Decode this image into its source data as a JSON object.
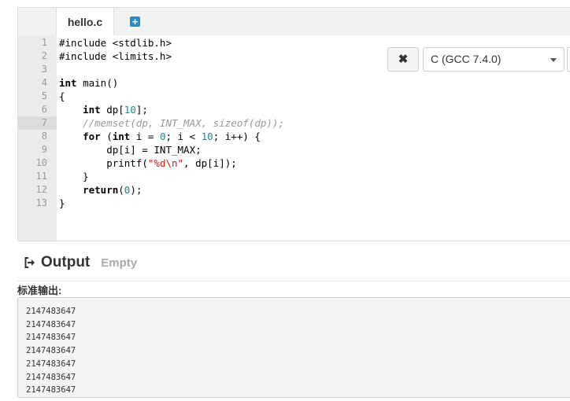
{
  "tabs": {
    "active": "hello.c",
    "add_icon": "plus-square-icon"
  },
  "toolbar": {
    "clear_icon": "✖",
    "language": "C (GCC 7.4.0)"
  },
  "editor": {
    "active_line": 7,
    "lines": [
      {
        "n": "1"
      },
      {
        "n": "2"
      },
      {
        "n": "3"
      },
      {
        "n": "4"
      },
      {
        "n": "5"
      },
      {
        "n": "6"
      },
      {
        "n": "7"
      },
      {
        "n": "8"
      },
      {
        "n": "9"
      },
      {
        "n": "10"
      },
      {
        "n": "11"
      },
      {
        "n": "12"
      },
      {
        "n": "13"
      }
    ],
    "code": [
      [
        {
          "t": "#include <stdlib.h>",
          "c": ""
        }
      ],
      [
        {
          "t": "#include <limits.h>",
          "c": ""
        }
      ],
      [],
      [
        {
          "t": "int",
          "c": "kw"
        },
        {
          "t": " main()",
          "c": ""
        }
      ],
      [
        {
          "t": "{",
          "c": ""
        }
      ],
      [
        {
          "t": "    ",
          "c": ""
        },
        {
          "t": "int",
          "c": "kw"
        },
        {
          "t": " dp[",
          "c": ""
        },
        {
          "t": "10",
          "c": "num"
        },
        {
          "t": "];",
          "c": ""
        }
      ],
      [
        {
          "t": "    ",
          "c": ""
        },
        {
          "t": "//memset(dp, INT_MAX, sizeof(dp));",
          "c": "cmt"
        }
      ],
      [
        {
          "t": "    ",
          "c": ""
        },
        {
          "t": "for",
          "c": "kw"
        },
        {
          "t": " (",
          "c": ""
        },
        {
          "t": "int",
          "c": "kw"
        },
        {
          "t": " i = ",
          "c": ""
        },
        {
          "t": "0",
          "c": "num"
        },
        {
          "t": "; i < ",
          "c": ""
        },
        {
          "t": "10",
          "c": "num"
        },
        {
          "t": "; i++) {",
          "c": ""
        }
      ],
      [
        {
          "t": "        dp[i] = INT_MAX;",
          "c": ""
        }
      ],
      [
        {
          "t": "        printf(",
          "c": ""
        },
        {
          "t": "\"%d\\n\"",
          "c": "str"
        },
        {
          "t": ", dp[i]);",
          "c": ""
        }
      ],
      [
        {
          "t": "    }",
          "c": ""
        }
      ],
      [
        {
          "t": "    ",
          "c": ""
        },
        {
          "t": "return",
          "c": "kw"
        },
        {
          "t": "(",
          "c": ""
        },
        {
          "t": "0",
          "c": "num"
        },
        {
          "t": ");",
          "c": ""
        }
      ],
      [
        {
          "t": "}",
          "c": ""
        }
      ]
    ]
  },
  "output": {
    "icon": "sign-out-icon",
    "title": "Output",
    "status": "Empty",
    "stdout_label": "标准输出:",
    "stdout_lines": [
      "2147483647",
      "2147483647",
      "2147483647",
      "2147483647",
      "2147483647",
      "2147483647",
      "2147483647"
    ]
  }
}
